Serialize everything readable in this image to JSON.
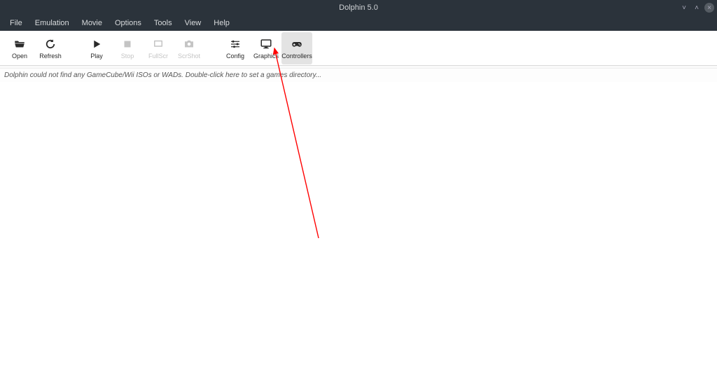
{
  "window": {
    "title": "Dolphin 5.0"
  },
  "menubar": {
    "items": [
      "File",
      "Emulation",
      "Movie",
      "Options",
      "Tools",
      "View",
      "Help"
    ]
  },
  "toolbar": {
    "open": "Open",
    "refresh": "Refresh",
    "play": "Play",
    "stop": "Stop",
    "fullscr": "FullScr",
    "scrshot": "ScrShot",
    "config": "Config",
    "graphics": "Graphics",
    "controllers": "Controllers"
  },
  "content": {
    "empty_message": "Dolphin could not find any GameCube/Wii ISOs or WADs. Double-click here to set a games directory..."
  },
  "annotation": {
    "arrow_color": "#ff0000"
  }
}
